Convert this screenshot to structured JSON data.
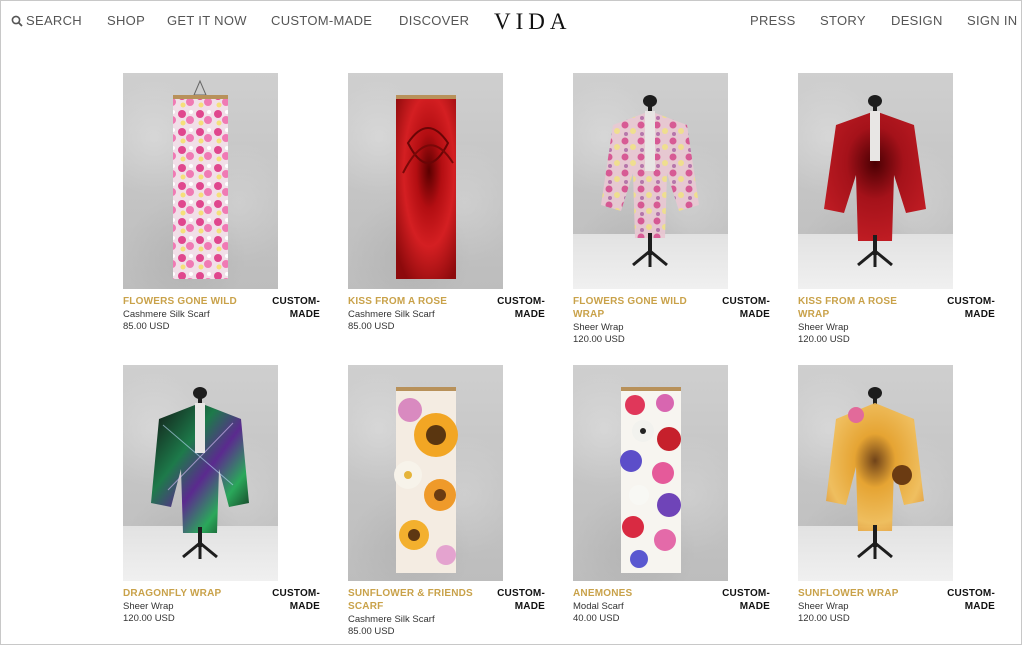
{
  "nav": {
    "search": "SEARCH",
    "shop": "SHOP",
    "get_it_now": "GET IT NOW",
    "custom_made": "CUSTOM-MADE",
    "discover": "DISCOVER",
    "logo": "VIDA",
    "press": "PRESS",
    "story": "STORY",
    "design": "DESIGN",
    "sign_in": "SIGN IN"
  },
  "products": [
    {
      "title": "FLOWERS GONE WILD",
      "type": "Cashmere Silk Scarf",
      "price": "85.00 USD",
      "tag_line1": "CUSTOM-",
      "tag_line2": "MADE",
      "image": "pink-floral-scarf"
    },
    {
      "title": "KISS FROM A ROSE",
      "type": "Cashmere Silk Scarf",
      "price": "85.00 USD",
      "tag_line1": "CUSTOM-",
      "tag_line2": "MADE",
      "image": "red-rose-scarf"
    },
    {
      "title": "FLOWERS GONE WILD WRAP",
      "type": "Sheer Wrap",
      "price": "120.00 USD",
      "tag_line1": "CUSTOM-",
      "tag_line2": "MADE",
      "image": "floral-wrap-mannequin"
    },
    {
      "title": "KISS FROM A ROSE WRAP",
      "type": "Sheer Wrap",
      "price": "120.00 USD",
      "tag_line1": "CUSTOM-",
      "tag_line2": "MADE",
      "image": "rose-wrap-mannequin"
    },
    {
      "title": "DRAGONFLY WRAP",
      "type": "Sheer Wrap",
      "price": "120.00 USD",
      "tag_line1": "CUSTOM-",
      "tag_line2": "MADE",
      "image": "dragonfly-wrap-mannequin"
    },
    {
      "title": "SUNFLOWER & FRIENDS SCARF",
      "type": "Cashmere Silk Scarf",
      "price": "85.00 USD",
      "tag_line1": "CUSTOM-",
      "tag_line2": "MADE",
      "image": "sunflower-scarf"
    },
    {
      "title": "ANEMONES",
      "type": "Modal Scarf",
      "price": "40.00 USD",
      "tag_line1": "CUSTOM-",
      "tag_line2": "MADE",
      "image": "anemones-scarf"
    },
    {
      "title": "SUNFLOWER WRAP",
      "type": "Sheer Wrap",
      "price": "120.00 USD",
      "tag_line1": "CUSTOM-",
      "tag_line2": "MADE",
      "image": "sunflower-wrap-mannequin"
    }
  ],
  "colors": {
    "accent": "#c9a24a",
    "nav_text": "#555555"
  }
}
